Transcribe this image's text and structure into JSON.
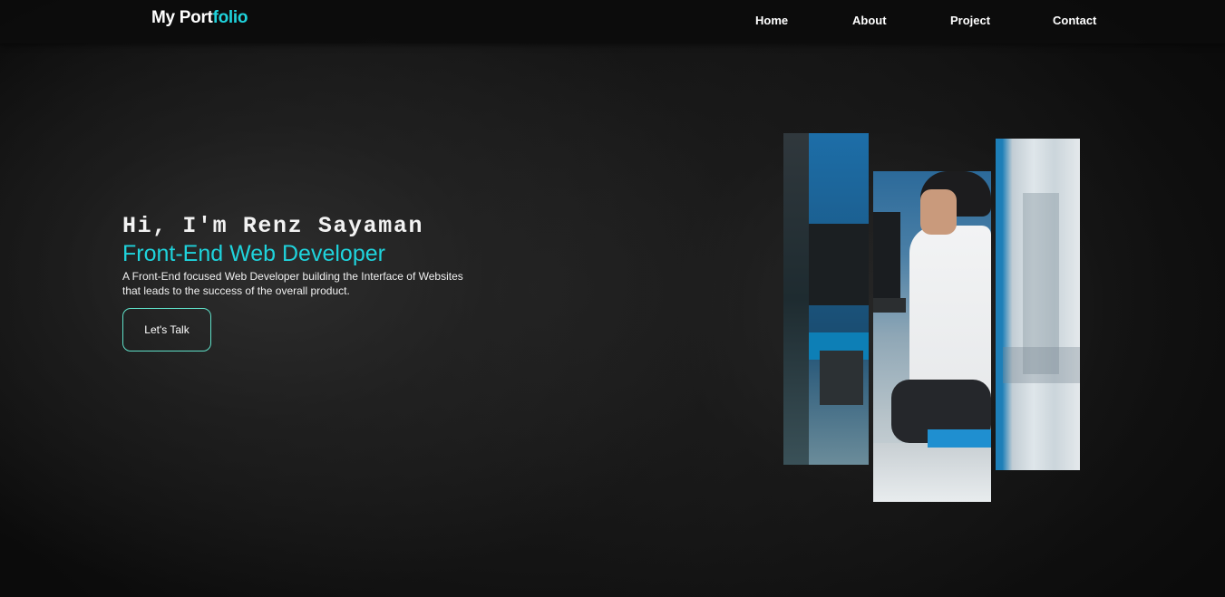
{
  "navbar": {
    "brand_prefix": "My Port",
    "brand_accent": "folio",
    "links": [
      {
        "label": "Home"
      },
      {
        "label": "About"
      },
      {
        "label": "Project"
      },
      {
        "label": "Contact"
      }
    ]
  },
  "hero": {
    "greeting": "Hi, I'm Renz Sayaman",
    "role": "Front-End Web Developer",
    "description": "A Front-End focused Web Developer building the Interface of Websites that leads to the success of the overall product.",
    "cta_label": "Let's Talk"
  },
  "colors": {
    "accent": "#1fd3dc",
    "background": "#141414",
    "text": "#ffffff",
    "button_border": "#5fe0c8"
  }
}
